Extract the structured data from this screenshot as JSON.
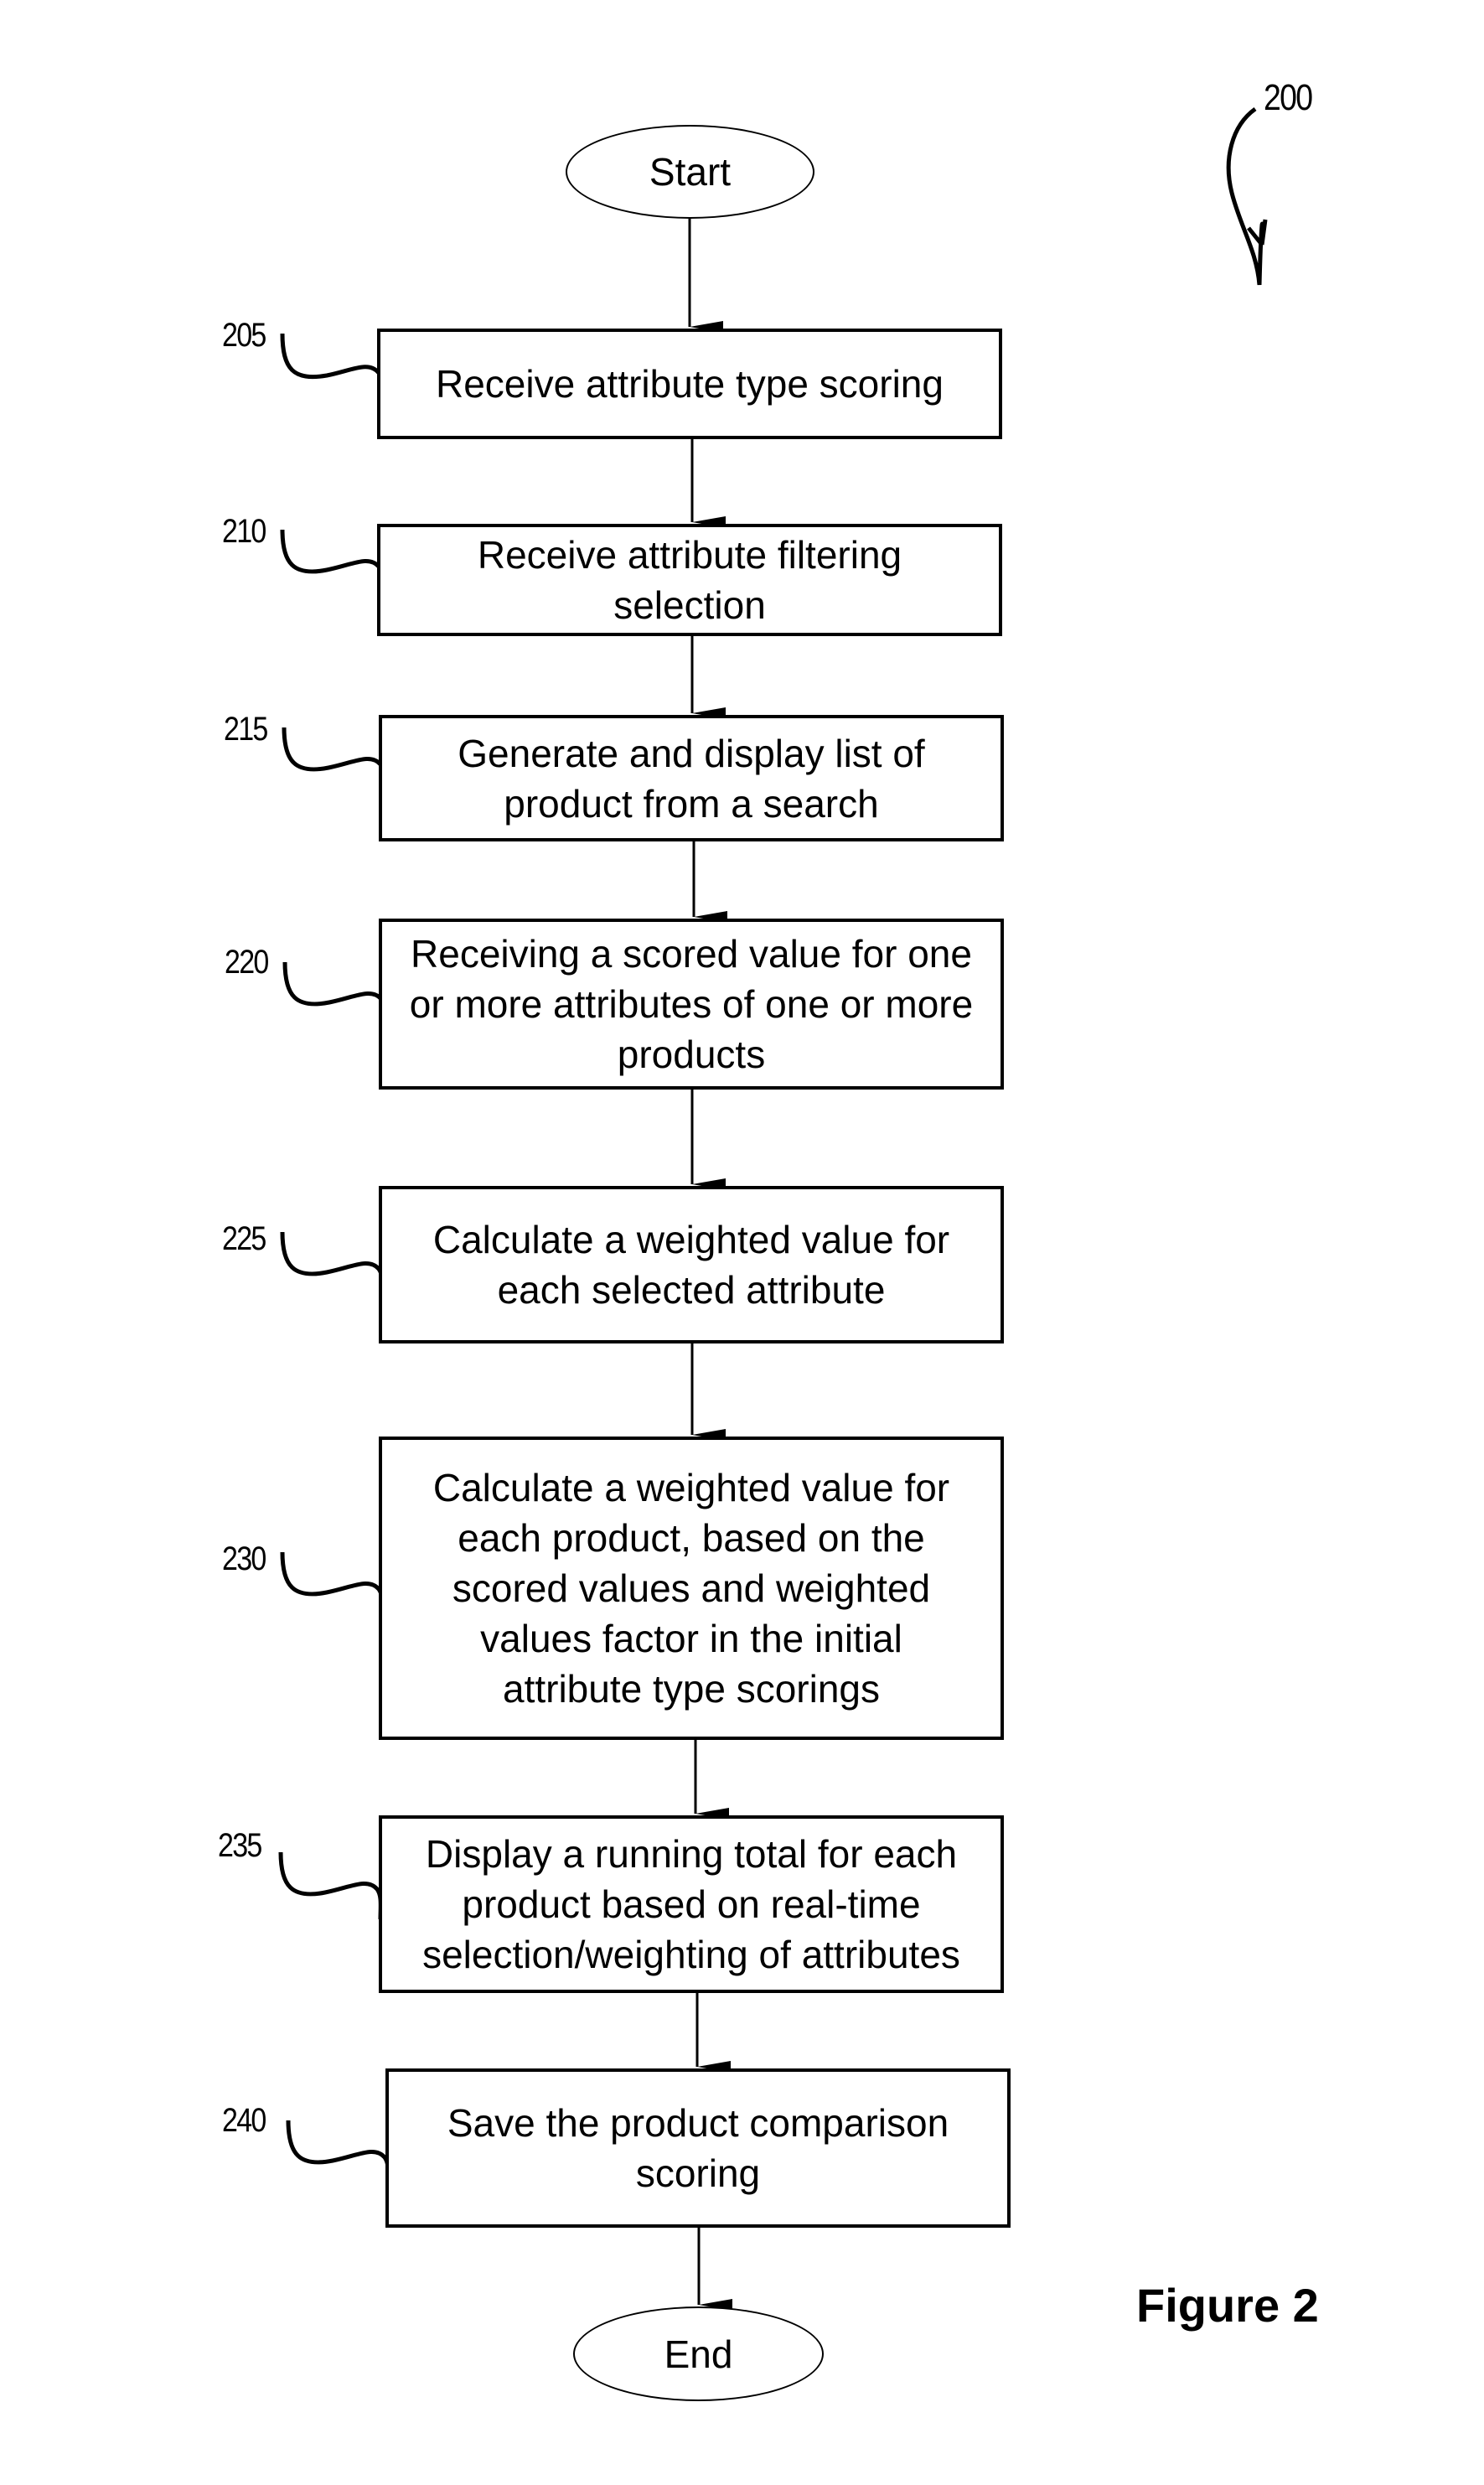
{
  "figure": {
    "label": "Figure 2",
    "reference_number": "200"
  },
  "start": {
    "label": "Start"
  },
  "end": {
    "label": "End"
  },
  "steps": [
    {
      "ref": "205",
      "text": "Receive attribute type scoring"
    },
    {
      "ref": "210",
      "text": "Receive attribute filtering selection"
    },
    {
      "ref": "215",
      "text": "Generate and display list of product from a search"
    },
    {
      "ref": "220",
      "text": "Receiving a scored value for one or more attributes of one or more products"
    },
    {
      "ref": "225",
      "text": "Calculate a weighted value for each selected attribute"
    },
    {
      "ref": "230",
      "text": "Calculate a weighted value for each product, based on the scored values and weighted values factor in the initial attribute type scorings"
    },
    {
      "ref": "235",
      "text": "Display a running total for each product based on real-time selection/weighting of attributes"
    },
    {
      "ref": "240",
      "text": "Save the product comparison scoring"
    }
  ]
}
